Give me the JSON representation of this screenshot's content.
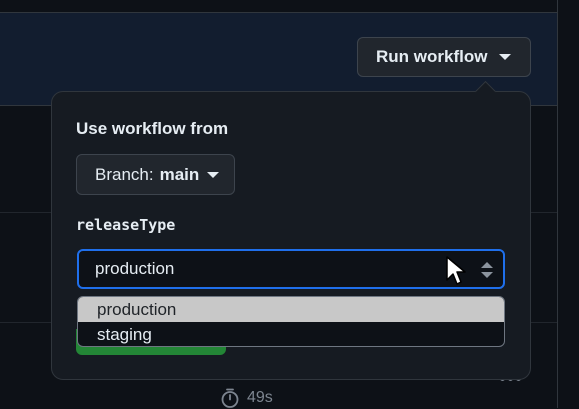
{
  "toolbar": {
    "run_workflow_label": "Run workflow"
  },
  "popover": {
    "heading": "Use workflow from",
    "branch": {
      "prefix": "Branch:",
      "name": "main"
    },
    "input": {
      "label": "releaseType",
      "selected": "production",
      "options": [
        "production",
        "staging"
      ]
    }
  },
  "background_run": {
    "duration": "49s"
  },
  "colors": {
    "accent_focus": "#1f6feb",
    "success_button": "#238636",
    "canvas": "#0d1117",
    "overlay": "#161b22"
  }
}
